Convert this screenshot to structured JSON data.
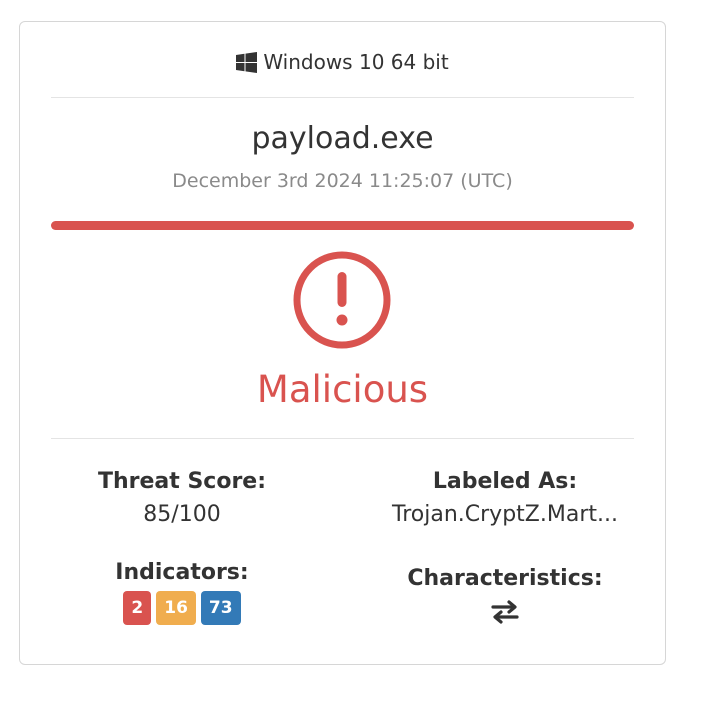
{
  "os": {
    "icon": "windows-logo-icon",
    "label": "Windows 10 64 bit"
  },
  "file": {
    "name": "payload.exe",
    "timestamp": "December 3rd 2024 11:25:07 (UTC)"
  },
  "verdict": {
    "icon": "exclamation-circle-icon",
    "label": "Malicious",
    "color": "#d9534f"
  },
  "threat_score": {
    "title": "Threat Score:",
    "value": "85/100"
  },
  "labeled_as": {
    "title": "Labeled As:",
    "value": "Trojan.CryptZ.Mart..."
  },
  "indicators": {
    "title": "Indicators:",
    "malicious": {
      "count": "2",
      "color": "#d9534f"
    },
    "suspicious": {
      "count": "16",
      "color": "#f0ad4e"
    },
    "informative": {
      "count": "73",
      "color": "#337ab7"
    }
  },
  "characteristics": {
    "title": "Characteristics:",
    "icon": "exchange-arrows-icon"
  }
}
